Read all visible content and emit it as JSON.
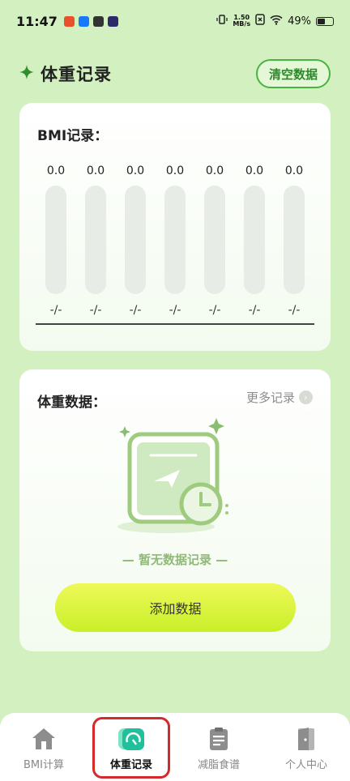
{
  "status_bar": {
    "time": "11:47",
    "net_speed_value": "1.50",
    "net_speed_unit": "MB/s",
    "battery": "49%"
  },
  "header": {
    "title": "体重记录",
    "clear_button": "清空数据"
  },
  "bmi_card": {
    "title": "BMI记录：",
    "bars": [
      {
        "value": "0.0",
        "date": "-/-"
      },
      {
        "value": "0.0",
        "date": "-/-"
      },
      {
        "value": "0.0",
        "date": "-/-"
      },
      {
        "value": "0.0",
        "date": "-/-"
      },
      {
        "value": "0.0",
        "date": "-/-"
      },
      {
        "value": "0.0",
        "date": "-/-"
      },
      {
        "value": "0.0",
        "date": "-/-"
      }
    ]
  },
  "weight_card": {
    "title": "体重数据：",
    "more_link": "更多记录",
    "empty_text": "— 暂无数据记录 —",
    "add_button": "添加数据"
  },
  "tabbar": {
    "tabs": [
      {
        "label": "BMI计算",
        "icon": "home-icon"
      },
      {
        "label": "体重记录",
        "icon": "gauge-icon",
        "active": true
      },
      {
        "label": "减脂食谱",
        "icon": "clipboard-icon"
      },
      {
        "label": "个人中心",
        "icon": "door-icon"
      }
    ]
  },
  "colors": {
    "background": "#d3f0c0",
    "accent_green": "#48b341",
    "button_yellow": "#d8f23a",
    "highlight_red": "#d42a2a"
  }
}
